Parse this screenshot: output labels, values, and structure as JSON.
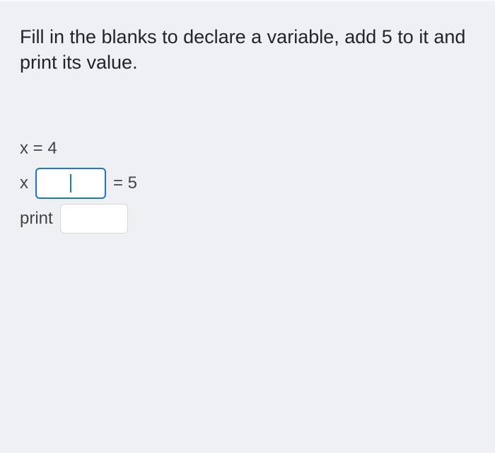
{
  "question": "Fill in the blanks to declare a variable, add 5 to it and print its value.",
  "code": {
    "line1": "x = 4",
    "line2_before": "x",
    "line2_after": "= 5",
    "line3_before": "print"
  }
}
